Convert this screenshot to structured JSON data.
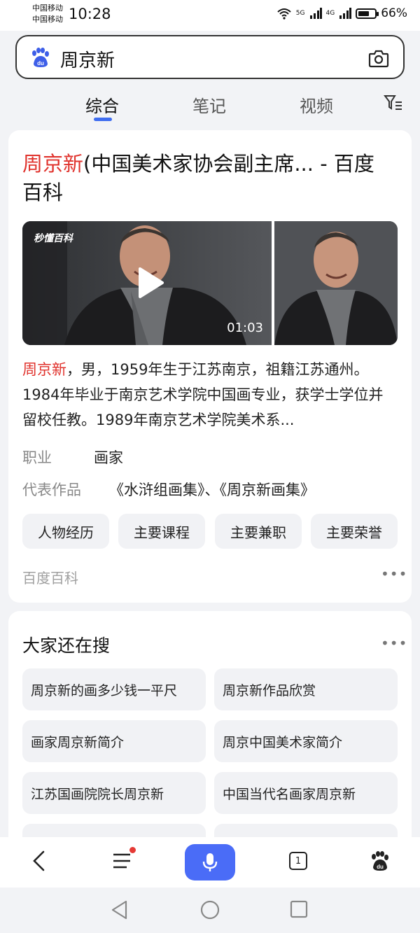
{
  "status_bar": {
    "carrier_1": "中国移动",
    "carrier_2": "中国移动",
    "time": "10:28",
    "net_1": "5G",
    "net_2": "4G",
    "battery_percent": "66%",
    "battery_level": 0.66
  },
  "search": {
    "query": "周京新"
  },
  "tabs": [
    {
      "label": "综合"
    },
    {
      "label": "笔记"
    },
    {
      "label": "视频"
    }
  ],
  "result": {
    "title_highlight": "周京新",
    "title_rest": "(中国美术家协会副主席... - 百度百科",
    "video_watermark": "秒懂百科",
    "video_duration": "01:03",
    "summary_highlight": "周京新",
    "summary_rest": "，男，1959年生于江苏南京，祖籍江苏通州。1984年毕业于南京艺术学院中国画专业，获学士学位并留校任教。1989年南京艺术学院美术系...",
    "occupation_key": "职业",
    "occupation_value": "画家",
    "works_key": "代表作品",
    "works_value": "《水浒组画集》、《周京新画集》",
    "chips": [
      "人物经历",
      "主要课程",
      "主要兼职",
      "主要荣誉"
    ],
    "source": "百度百科"
  },
  "related": {
    "title": "大家还在搜",
    "items": [
      "周京新的画多少钱一平尺",
      "周京新作品欣赏",
      "画家周京新简介",
      "周京中国美术家简介",
      "江苏国画院院长周京新",
      "中国当代名画家周京新"
    ]
  },
  "bottom_nav": {
    "tab_count": "1"
  },
  "colors": {
    "accent": "#4a6cf7",
    "highlight": "#e0322c",
    "tab_underline": "#3f6df0"
  }
}
